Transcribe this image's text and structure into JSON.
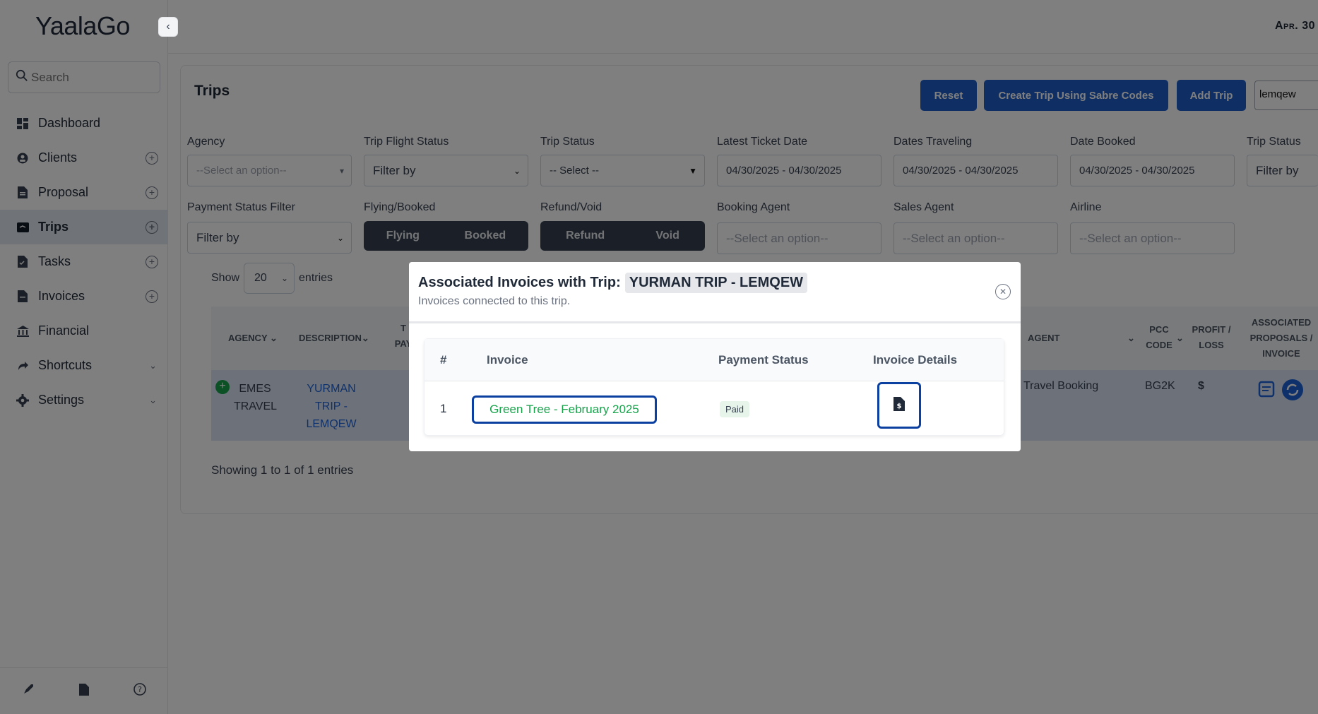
{
  "app": {
    "name": "YaalaGo",
    "date": "Apr. 30"
  },
  "sidebar": {
    "search_placeholder": "Search",
    "items": [
      {
        "label": "Dashboard",
        "icon": "dashboard-icon"
      },
      {
        "label": "Clients",
        "icon": "clients-icon"
      },
      {
        "label": "Proposal",
        "icon": "proposal-icon"
      },
      {
        "label": "Trips",
        "icon": "trips-icon",
        "active": true
      },
      {
        "label": "Tasks",
        "icon": "tasks-icon"
      },
      {
        "label": "Invoices",
        "icon": "invoices-icon"
      },
      {
        "label": "Financial",
        "icon": "bank-icon"
      },
      {
        "label": "Shortcuts",
        "icon": "share-icon"
      },
      {
        "label": "Settings",
        "icon": "gear-icon"
      }
    ]
  },
  "page": {
    "title": "Trips",
    "buttons": {
      "reset": "Reset",
      "create_sabre": "Create Trip Using Sabre Codes",
      "add_trip": "Add Trip"
    },
    "search_value": "lemqew",
    "filters": {
      "agency": {
        "label": "Agency",
        "value": "--Select an option--"
      },
      "trip_flight_status": {
        "label": "Trip Flight Status",
        "value": "Filter by"
      },
      "trip_status": {
        "label": "Trip Status",
        "value": "-- Select --"
      },
      "latest_ticket_date": {
        "label": "Latest Ticket Date",
        "value": "04/30/2025 - 04/30/2025"
      },
      "dates_traveling": {
        "label": "Dates Traveling",
        "value": "04/30/2025 - 04/30/2025"
      },
      "date_booked": {
        "label": "Date Booked",
        "value": "04/30/2025 - 04/30/2025"
      },
      "trip_status_2": {
        "label": "Trip Status",
        "value": "Filter by"
      },
      "payment_status": {
        "label": "Payment Status Filter",
        "value": "Filter by"
      },
      "flying_booked": {
        "label": "Flying/Booked",
        "options": [
          "Flying",
          "Booked"
        ]
      },
      "refund_void": {
        "label": "Refund/Void",
        "options": [
          "Refund",
          "Void"
        ]
      },
      "booking_agent": {
        "label": "Booking Agent",
        "value": "--Select an option--"
      },
      "sales_agent": {
        "label": "Sales Agent",
        "value": "--Select an option--"
      },
      "airline": {
        "label": "Airline",
        "value": "--Select an option--"
      }
    },
    "show": {
      "prefix": "Show",
      "value": "20",
      "suffix": "entries"
    },
    "table": {
      "headers": {
        "agency": "AGENCY",
        "description": "DESCRIPTION",
        "t": "T",
        "pay": "PAY",
        "agent": "AGENT",
        "pcc_code": "PCC CODE",
        "profit_loss": "PROFIT / LOSS",
        "associated": "ASSOCIATED PROPOSALS / INVOICE"
      },
      "row": {
        "agency": "EMES TRAVEL",
        "description": "YURMAN TRIP - LEMQEW",
        "agent": "Travel Booking",
        "pcc": "BG2K",
        "profit": "$"
      }
    },
    "showing": "Showing 1 to 1 of 1 entries"
  },
  "modal": {
    "title_prefix": "Associated Invoices with Trip:",
    "trip_name": "YURMAN TRIP - LEMQEW",
    "subtitle": "Invoices connected to this trip.",
    "headers": {
      "num": "#",
      "invoice": "Invoice",
      "payment_status": "Payment Status",
      "details": "Invoice Details"
    },
    "rows": [
      {
        "num": "1",
        "invoice": "Green Tree - February 2025",
        "status": "Paid"
      }
    ]
  }
}
